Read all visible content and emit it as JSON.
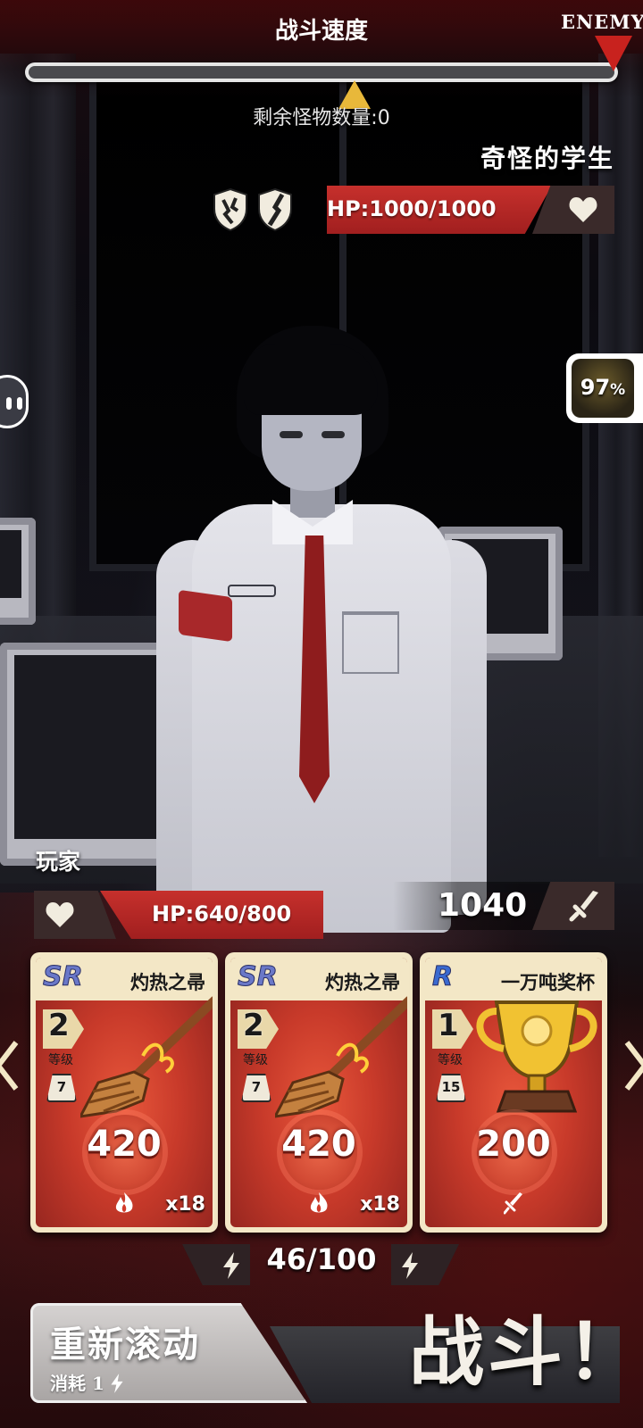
{
  "hud": {
    "speed_title": "战斗速度",
    "enemy_tag": "ENEMY",
    "remaining_text": "剩余怪物数量:0"
  },
  "enemy": {
    "name": "奇怪的学生",
    "hp_text": "HP:1000/1000",
    "hp_current": 1000,
    "hp_max": 1000,
    "status_icons": [
      "broken-shield-icon",
      "cracked-shield-icon"
    ]
  },
  "side": {
    "odds_value": "97",
    "odds_unit": "%"
  },
  "player": {
    "name": "玩家",
    "hp_text": "HP:640/800",
    "hp_current": 640,
    "hp_max": 800,
    "attack": "1040"
  },
  "cards": [
    {
      "rarity": "SR",
      "name": "灼热之帚",
      "level": "2",
      "level_label": "等级",
      "weight": "7",
      "power": "420",
      "type_icon": "fire-icon",
      "multiplier": "x18",
      "art": "broom-icon"
    },
    {
      "rarity": "SR",
      "name": "灼热之帚",
      "level": "2",
      "level_label": "等级",
      "weight": "7",
      "power": "420",
      "type_icon": "fire-icon",
      "multiplier": "x18",
      "art": "broom-icon"
    },
    {
      "rarity": "R",
      "name": "一万吨奖杯",
      "level": "1",
      "level_label": "等级",
      "weight": "15",
      "power": "200",
      "type_icon": "sword-icon",
      "multiplier": "",
      "art": "trophy-icon"
    }
  ],
  "energy": {
    "text": "46/100",
    "current": 46,
    "max": 100
  },
  "buttons": {
    "reroll_label": "重新滚动",
    "reroll_cost": "消耗 1",
    "fight_label": "战斗！"
  },
  "colors": {
    "hp_red": "#b8282a",
    "speed_marker_enemy": "#c8221e",
    "speed_marker_player": "#e8b83a",
    "card_frame": "#f3e7c6"
  }
}
